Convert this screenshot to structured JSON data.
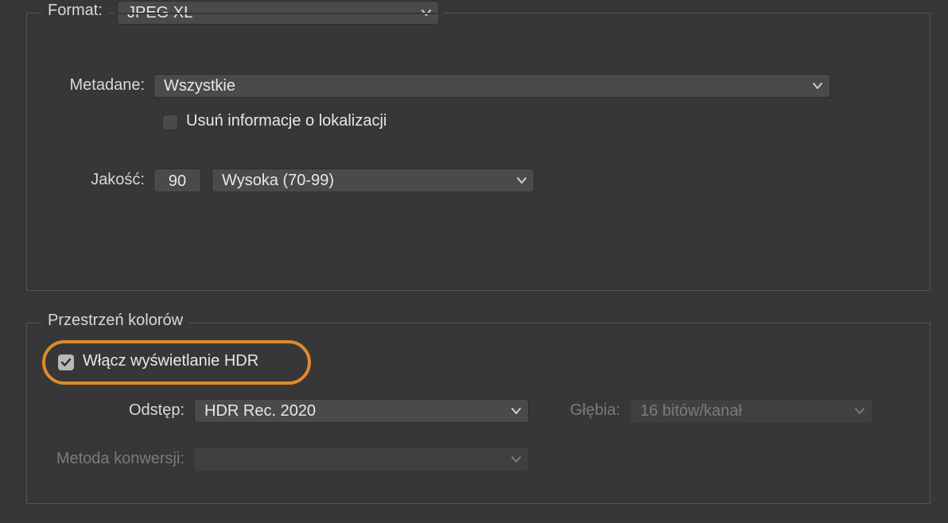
{
  "format_section": {
    "legend": "Format:",
    "format_value": "JPEG XL",
    "metadata_label": "Metadane:",
    "metadata_value": "Wszystkie",
    "remove_location_label": "Usuń informacje o lokalizacji",
    "quality_label": "Jakość:",
    "quality_value": "90",
    "quality_preset_value": "Wysoka (70-99)"
  },
  "colorspace_section": {
    "legend": "Przestrzeń kolorów",
    "enable_hdr_label": "Włącz wyświetlanie HDR",
    "space_label": "Odstęp:",
    "space_value": "HDR Rec. 2020",
    "depth_label": "Głębia:",
    "depth_value": "16 bitów/kanał",
    "intent_label": "Metoda konwersji:"
  }
}
